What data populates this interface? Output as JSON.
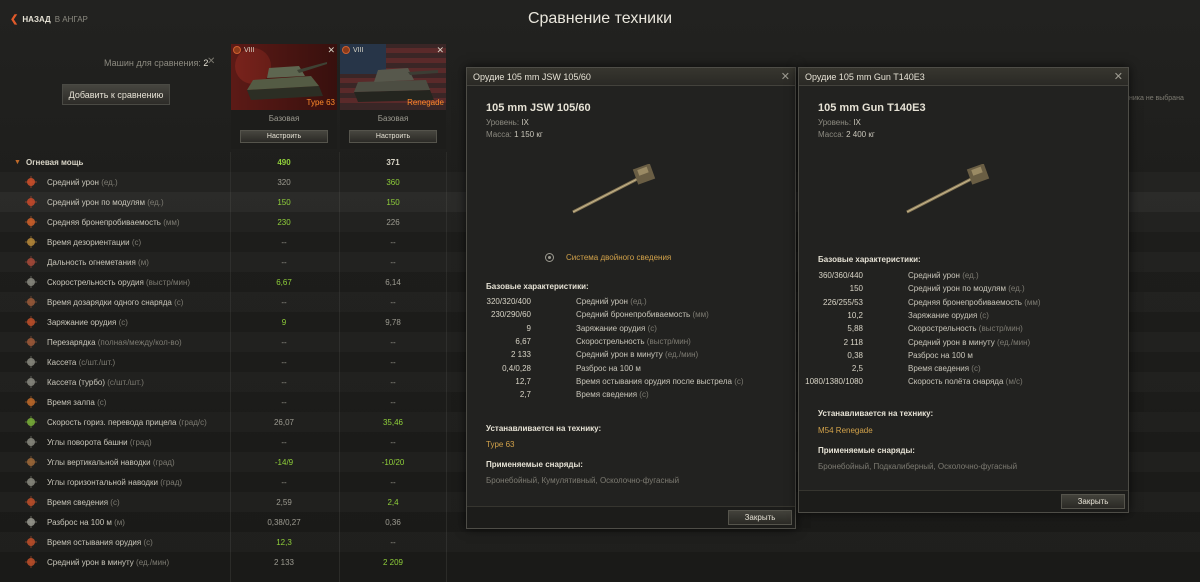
{
  "header": {
    "back_label": "НАЗАД",
    "back_sub": "В АНГАР",
    "title": "Сравнение техники"
  },
  "compare": {
    "count_label": "Машин для сравнения:",
    "count": "2",
    "add_button": "Добавить к сравнению"
  },
  "tanks": [
    {
      "tier": "VIII",
      "name": "Type 63",
      "config": "Базовая",
      "config_button": "Настроить",
      "flag": "china"
    },
    {
      "tier": "VIII",
      "name": "Renegade",
      "config": "Базовая",
      "config_button": "Настроить",
      "flag": "usa"
    }
  ],
  "right_note": "ника не выбрана",
  "section": {
    "label": "Огневая мощь",
    "v1": "490",
    "v2": "371",
    "v1_green": true,
    "v2_green": false
  },
  "rows": [
    {
      "label": "Средний урон",
      "unit": "(ед.)",
      "v1": "320",
      "v2": "360",
      "g1": false,
      "g2": true,
      "icon": "damage-icon"
    },
    {
      "label": "Средний урон по модулям",
      "unit": "(ед.)",
      "v1": "150",
      "v2": "150",
      "g1": true,
      "g2": true,
      "icon": "module-damage-icon"
    },
    {
      "label": "Средняя бронепробиваемость",
      "unit": "(мм)",
      "v1": "230",
      "v2": "226",
      "g1": true,
      "g2": false,
      "icon": "penetration-icon"
    },
    {
      "label": "Время дезориентации",
      "unit": "(с)",
      "v1": "--",
      "v2": "--",
      "g1": false,
      "g2": false,
      "icon": "stun-icon"
    },
    {
      "label": "Дальность огнеметания",
      "unit": "(м)",
      "v1": "--",
      "v2": "--",
      "g1": false,
      "g2": false,
      "icon": "flame-range-icon"
    },
    {
      "label": "Скорострельность орудия",
      "unit": "(выстр/мин)",
      "v1": "6,67",
      "v2": "6,14",
      "g1": true,
      "g2": false,
      "icon": "rate-of-fire-icon"
    },
    {
      "label": "Время дозарядки одного снаряда",
      "unit": "(с)",
      "v1": "--",
      "v2": "--",
      "g1": false,
      "g2": false,
      "icon": "intra-clip-reload-icon"
    },
    {
      "label": "Заряжание орудия",
      "unit": "(с)",
      "v1": "9",
      "v2": "9,78",
      "g1": true,
      "g2": false,
      "icon": "reload-icon"
    },
    {
      "label": "Перезарядка",
      "unit": "(полная/между/кол-во)",
      "v1": "--",
      "v2": "--",
      "g1": false,
      "g2": false,
      "icon": "autoreload-icon"
    },
    {
      "label": "Кассета",
      "unit": "(с/шт./шт.)",
      "v1": "--",
      "v2": "--",
      "g1": false,
      "g2": false,
      "icon": "clip-icon"
    },
    {
      "label": "Кассета (турбо)",
      "unit": "(с/шт./шт.)",
      "v1": "--",
      "v2": "--",
      "g1": false,
      "g2": false,
      "icon": "clip-turbo-icon"
    },
    {
      "label": "Время залпа",
      "unit": "(с)",
      "v1": "--",
      "v2": "--",
      "g1": false,
      "g2": false,
      "icon": "salvo-icon"
    },
    {
      "label": "Скорость гориз. перевода прицела",
      "unit": "(град/с)",
      "v1": "26,07",
      "v2": "35,46",
      "g1": false,
      "g2": true,
      "icon": "traverse-icon"
    },
    {
      "label": "Углы поворота башни",
      "unit": "(град)",
      "v1": "--",
      "v2": "--",
      "g1": false,
      "g2": false,
      "icon": "turret-angle-icon"
    },
    {
      "label": "Углы вертикальной наводки",
      "unit": "(град)",
      "v1": "-14/9",
      "v2": "-10/20",
      "g1": true,
      "g2": true,
      "icon": "vertical-angle-icon"
    },
    {
      "label": "Углы горизонтальной наводки",
      "unit": "(град)",
      "v1": "--",
      "v2": "--",
      "g1": false,
      "g2": false,
      "icon": "horizontal-angle-icon"
    },
    {
      "label": "Время сведения",
      "unit": "(с)",
      "v1": "2,59",
      "v2": "2,4",
      "g1": false,
      "g2": true,
      "icon": "aim-time-icon"
    },
    {
      "label": "Разброс на 100 м",
      "unit": "(м)",
      "v1": "0,38/0,27",
      "v2": "0,36",
      "g1": false,
      "g2": false,
      "icon": "dispersion-icon"
    },
    {
      "label": "Время остывания орудия",
      "unit": "(с)",
      "v1": "12,3",
      "v2": "--",
      "g1": true,
      "g2": false,
      "icon": "cooldown-icon"
    },
    {
      "label": "Средний урон в минуту",
      "unit": "(ед./мин)",
      "v1": "2 133",
      "v2": "2 209",
      "g1": false,
      "g2": true,
      "icon": "dpm-icon"
    }
  ],
  "panel1": {
    "title": "Орудие 105 mm JSW 105/60",
    "name": "105 mm JSW 105/60",
    "level_label": "Уровень:",
    "level": "IX",
    "mass_label": "Масса:",
    "mass": "1 150 кг",
    "feature": "Система двойного сведения",
    "base_title": "Базовые характеристики:",
    "stats": [
      {
        "v": "320/320/400",
        "l": "Средний урон",
        "u": "(ед.)"
      },
      {
        "v": "230/290/60",
        "l": "Средний бронепробиваемость",
        "u": "(мм)"
      },
      {
        "v": "9",
        "l": "Заряжание орудия",
        "u": "(с)"
      },
      {
        "v": "6,67",
        "l": "Скорострельность",
        "u": "(выстр/мин)"
      },
      {
        "v": "2 133",
        "l": "Средний урон в минуту",
        "u": "(ед./мин)"
      },
      {
        "v": "0,4/0,28",
        "l": "Разброс на 100 м",
        "u": ""
      },
      {
        "v": "12,7",
        "l": "Время остывания орудия после выстрела",
        "u": "(с)"
      },
      {
        "v": "2,7",
        "l": "Время сведения",
        "u": "(с)"
      }
    ],
    "installed_title": "Устанавливается на технику:",
    "installed": "Type 63",
    "ammo_title": "Применяемые снаряды:",
    "ammo": "Бронебойный, Кумулятивный, Осколочно-фугасный",
    "close": "Закрыть"
  },
  "panel2": {
    "title": "Орудие 105 mm Gun T140E3",
    "name": "105 mm Gun T140E3",
    "level_label": "Уровень:",
    "level": "IX",
    "mass_label": "Масса:",
    "mass": "2 400 кг",
    "base_title": "Базовые характеристики:",
    "stats": [
      {
        "v": "360/360/440",
        "l": "Средний урон",
        "u": "(ед.)"
      },
      {
        "v": "150",
        "l": "Средний урон по модулям",
        "u": "(ед.)"
      },
      {
        "v": "226/255/53",
        "l": "Средняя бронепробиваемость",
        "u": "(мм)"
      },
      {
        "v": "10,2",
        "l": "Заряжание орудия",
        "u": "(с)"
      },
      {
        "v": "5,88",
        "l": "Скорострельность",
        "u": "(выстр/мин)"
      },
      {
        "v": "2 118",
        "l": "Средний урон в минуту",
        "u": "(ед./мин)"
      },
      {
        "v": "0,38",
        "l": "Разброс на 100 м",
        "u": ""
      },
      {
        "v": "2,5",
        "l": "Время сведения",
        "u": "(с)"
      },
      {
        "v": "1080/1380/1080",
        "l": "Скорость полёта снаряда",
        "u": "(м/с)"
      }
    ],
    "installed_title": "Устанавливается на технику:",
    "installed": "M54 Renegade",
    "ammo_title": "Применяемые снаряды:",
    "ammo": "Бронебойный, Подкалиберный, Осколочно-фугасный",
    "close": "Закрыть"
  },
  "colors": {
    "green": "#8fcf3a",
    "orange": "#ff8a2a",
    "gold": "#d2a24a"
  }
}
